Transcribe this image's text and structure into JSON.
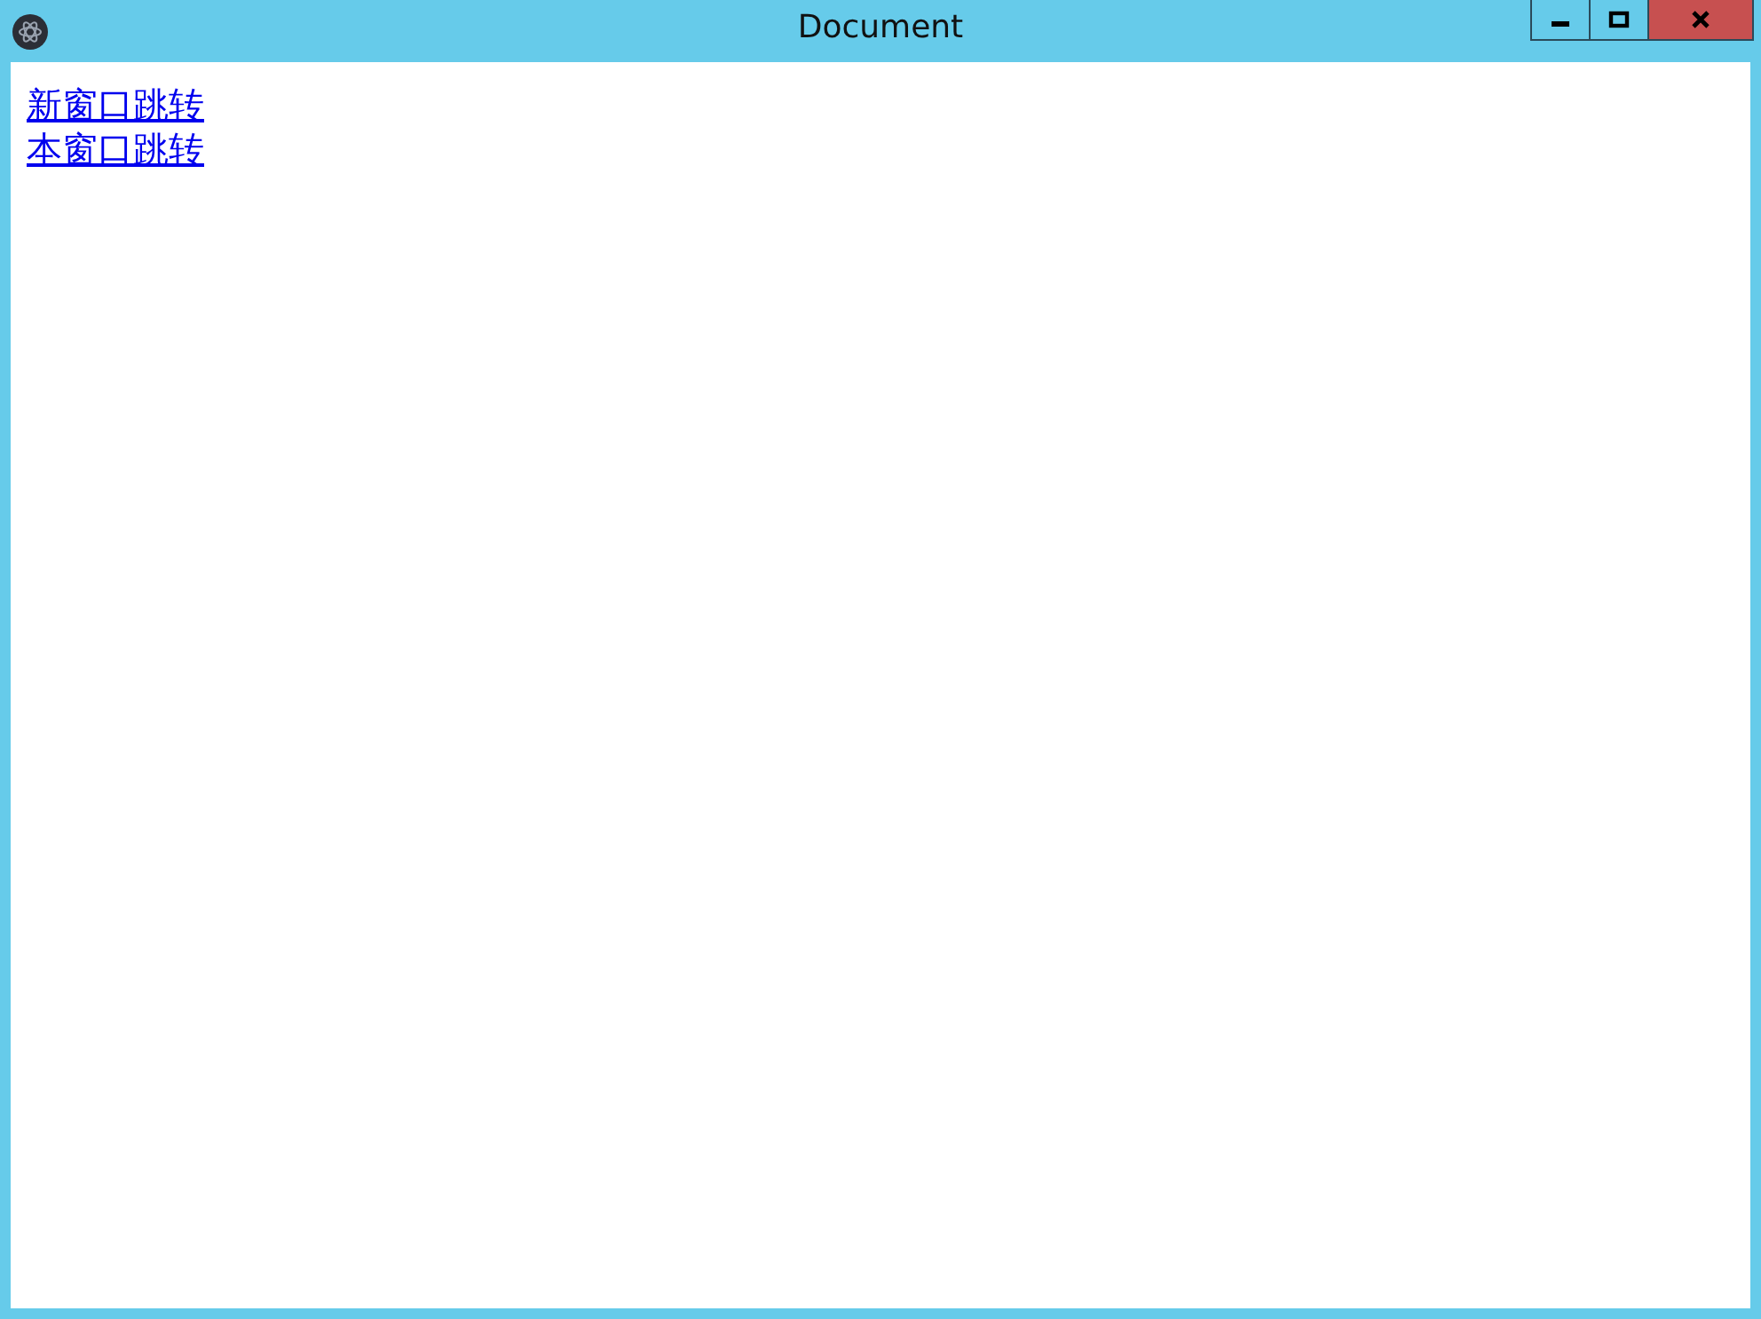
{
  "window": {
    "title": "Document"
  },
  "links": [
    {
      "label": "新窗口跳转"
    },
    {
      "label": "本窗口跳转"
    }
  ]
}
